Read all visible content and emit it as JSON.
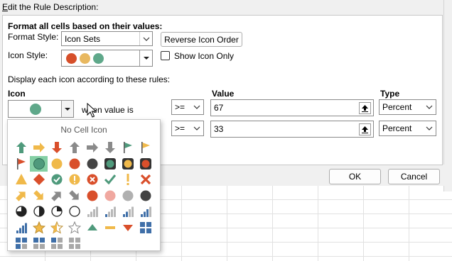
{
  "dialog": {
    "section_label": "Edit the Rule Description:",
    "heading": "Format all cells based on their values:",
    "format_style_label": "Format Style:",
    "format_style_value": "Icon Sets",
    "reverse_button": "Reverse Icon Order",
    "icon_style_label": "Icon Style:",
    "icon_style_colors": [
      "#d64f2a",
      "#e8b860",
      "#5fa88a"
    ],
    "show_icon_only_label": "Show Icon Only",
    "show_icon_only_checked": false,
    "rules_caption": "Display each icon according to these rules:",
    "col_icon": "Icon",
    "col_value": "Value",
    "col_type": "Type",
    "rules": [
      {
        "icon_color": "#5fa88a",
        "condition": "when value is",
        "operator": ">=",
        "value": "67",
        "type": "Percent"
      },
      {
        "operator": ">=",
        "value": "33",
        "type": "Percent"
      }
    ],
    "ok_button": "OK",
    "cancel_button": "Cancel"
  },
  "icon_picker": {
    "title": "No Cell Icon",
    "selected_icon": "green-circle-icon",
    "icons": [
      "green-up-arrow-icon",
      "yellow-right-arrow-icon",
      "red-down-arrow-icon",
      "gray-up-arrow-icon",
      "gray-right-arrow-icon",
      "gray-down-arrow-icon",
      "green-flag-icon",
      "yellow-flag-icon",
      "red-flag-icon",
      "green-circle-icon",
      "yellow-circle-icon",
      "red-circle-icon",
      "black-circle-icon",
      "green-traffic-light-icon",
      "yellow-traffic-light-icon",
      "red-traffic-light-icon",
      "yellow-triangle-icon",
      "red-diamond-icon",
      "green-check-symbol-icon",
      "yellow-exclamation-symbol-icon",
      "red-x-symbol-icon",
      "green-check-icon",
      "yellow-exclamation-icon",
      "red-x-icon",
      "yellow-up-right-arrow-icon",
      "yellow-down-right-arrow-icon",
      "gray-up-right-arrow-icon",
      "gray-down-right-arrow-icon",
      "red-circle-icon",
      "pink-circle-icon",
      "gray-circle-icon",
      "black-circle-icon",
      "three-quarters-circle-icon",
      "half-circle-icon",
      "quarter-circle-icon",
      "empty-circle-icon",
      "signal-0-bars-icon",
      "signal-1-bar-icon",
      "signal-2-bars-icon",
      "signal-3-bars-icon",
      "signal-4-bars-icon",
      "gold-star-icon",
      "half-star-icon",
      "empty-star-icon",
      "green-up-triangle-icon",
      "yellow-dash-icon",
      "red-down-triangle-icon",
      "four-boxes-icon",
      "three-boxes-icon",
      "two-boxes-icon",
      "one-box-icon",
      "zero-boxes-icon"
    ]
  }
}
